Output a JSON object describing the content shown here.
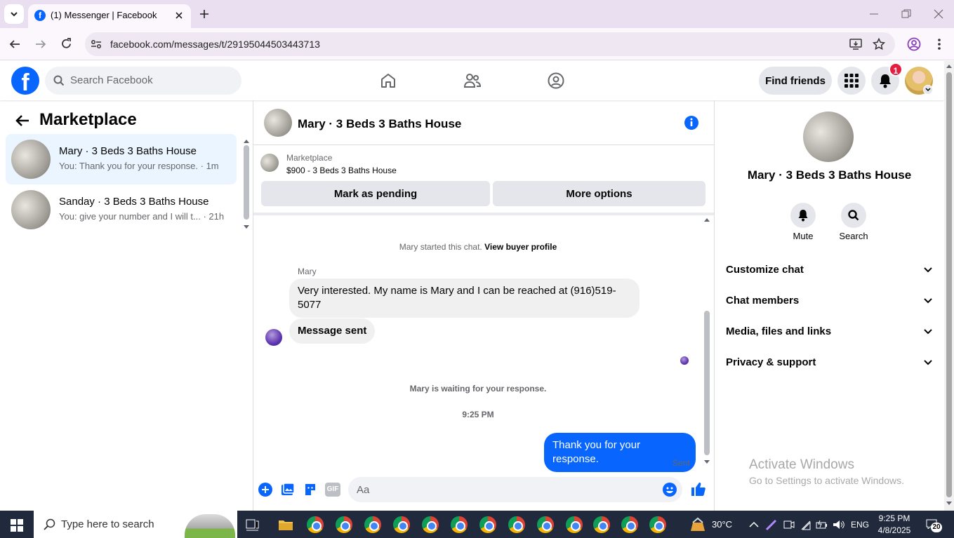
{
  "browser": {
    "tab_title": "(1) Messenger | Facebook",
    "url": "facebook.com/messages/t/29195044503443713"
  },
  "header": {
    "search_placeholder": "Search Facebook",
    "find_friends": "Find friends",
    "notification_count": "1"
  },
  "sidebar": {
    "title": "Marketplace",
    "conversations": [
      {
        "name": "Mary · 3 Beds 3 Baths House",
        "preview": "You: Thank you for your response. · 1m",
        "selected": true
      },
      {
        "name": "Sanday · 3 Beds 3 Baths House",
        "preview": "You: give your number and I will t... · 21h",
        "selected": false
      }
    ]
  },
  "chat": {
    "title": "Mary · 3 Beds 3 Baths House",
    "listing_source": "Marketplace",
    "listing_price": "$900 - 3 Beds 3 Baths House",
    "mark_pending": "Mark as pending",
    "more_options": "More options",
    "started_text": "Mary started this chat.",
    "view_buyer": "View buyer profile",
    "sender_name": "Mary",
    "msg1": "Very interested.  My name is Mary and I can be reached at (916)519-5077",
    "msg2": "Message sent",
    "waiting_text": "Mary is waiting for your response.",
    "timestamp": "9:25 PM",
    "my_msg": "Thank you for your response.",
    "sent_status": "Sent",
    "composer_placeholder": "Aa"
  },
  "info_panel": {
    "name": "Mary · 3 Beds 3 Baths House",
    "mute": "Mute",
    "search": "Search",
    "sections": [
      "Customize chat",
      "Chat members",
      "Media, files and links",
      "Privacy & support"
    ]
  },
  "watermark": {
    "line1": "Activate Windows",
    "line2": "Go to Settings to activate Windows."
  },
  "taskbar": {
    "search_placeholder": "Type here to search",
    "weather": "30°C",
    "lang": "ENG",
    "time": "9:25 PM",
    "date": "4/8/2025",
    "notif": "20"
  },
  "colors": {
    "fb_blue": "#0866ff",
    "badge_red": "#e41e3f",
    "selected_bg": "#ebf5ff"
  }
}
